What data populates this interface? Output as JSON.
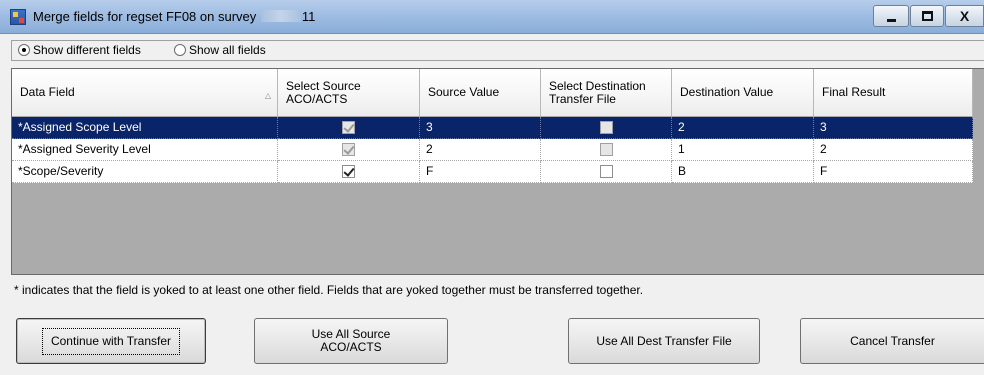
{
  "window": {
    "title_prefix": "Merge fields for regset FF08 on survey",
    "title_suffix": "11",
    "minimize": "minimize",
    "maximize": "maximize",
    "close": "X"
  },
  "filter": {
    "options": [
      {
        "label": "Show different fields",
        "checked": true
      },
      {
        "label": "Show all fields",
        "checked": false
      }
    ]
  },
  "grid": {
    "columns": [
      {
        "label": "Data Field",
        "sort": "ascending"
      },
      {
        "label": "Select Source ACO/ACTS"
      },
      {
        "label": "Source Value"
      },
      {
        "label": "Select Destination Transfer File"
      },
      {
        "label": "Destination Value"
      },
      {
        "label": "Final Result"
      }
    ],
    "rows": [
      {
        "field": "*Assigned Scope Level",
        "source_selected": true,
        "source_enabled": false,
        "source_value": "3",
        "dest_selected": false,
        "dest_enabled": false,
        "dest_value": "2",
        "final": "3",
        "selected": true
      },
      {
        "field": "*Assigned Severity Level",
        "source_selected": true,
        "source_enabled": false,
        "source_value": "2",
        "dest_selected": false,
        "dest_enabled": false,
        "dest_value": "1",
        "final": "2",
        "selected": false
      },
      {
        "field": "*Scope/Severity",
        "source_selected": true,
        "source_enabled": true,
        "source_value": "F",
        "dest_selected": false,
        "dest_enabled": true,
        "dest_value": "B",
        "final": "F",
        "selected": false
      }
    ]
  },
  "note": "* indicates that the field is yoked to at least one other field.  Fields that are yoked together must be transferred together.",
  "buttons": {
    "continue": "Continue with Transfer",
    "use_source_line1": "Use All Source",
    "use_source_line2": "ACO/ACTS",
    "use_dest": "Use All Dest Transfer File",
    "cancel": "Cancel Transfer"
  },
  "colors": {
    "selection": "#0a246a",
    "titlebar": "#9fbde3",
    "window_bg": "#f0f0f0",
    "grid_bg": "#ababab"
  }
}
